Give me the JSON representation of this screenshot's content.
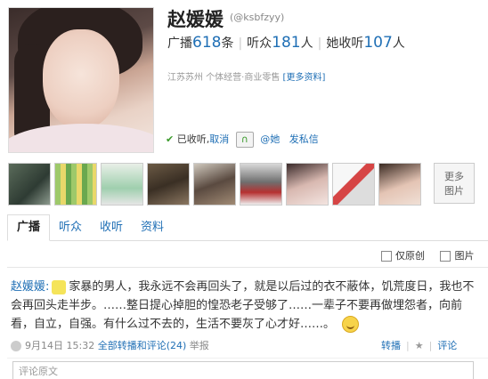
{
  "profile": {
    "name": "赵媛媛",
    "handle": "(@ksbfzyy)",
    "stats": [
      {
        "label": "广播",
        "value": "618",
        "unit": "条"
      },
      {
        "label": "听众",
        "value": "181",
        "unit": "人"
      },
      {
        "label": "她收听",
        "value": "107",
        "unit": "人"
      }
    ],
    "location": "江苏苏州 个体经营·商业零售",
    "more_info": "[更多资料]",
    "listened_label": "已收听,",
    "cancel_label": "取消",
    "mention_label": "@她",
    "message_label": "发私信"
  },
  "photos": {
    "more_label_1": "更多",
    "more_label_2": "图片"
  },
  "tabs": [
    "广播",
    "听众",
    "收听",
    "资料"
  ],
  "filters": {
    "original_only": "仅原创",
    "images": "图片"
  },
  "post": {
    "author": "赵媛媛:",
    "text": "家暴的男人，我永远不会再回头了，就是以后过的衣不蔽体，饥荒度日，我也不会再回头走半步。……整日提心掉胆的惶恐老子受够了……一辈子不要再做埋怨者，向前看，自立，自强。有什么过不去的，生活不要灰了心才好……。",
    "time": "9月14日 15:32",
    "source": "全部转播和评论",
    "count": "(24)",
    "report": "举报",
    "repost": "转播",
    "comment": "评论",
    "comment_placeholder": "评论原文"
  },
  "colors": {
    "link": "#1f6fb5",
    "check": "#3a9a2a"
  }
}
